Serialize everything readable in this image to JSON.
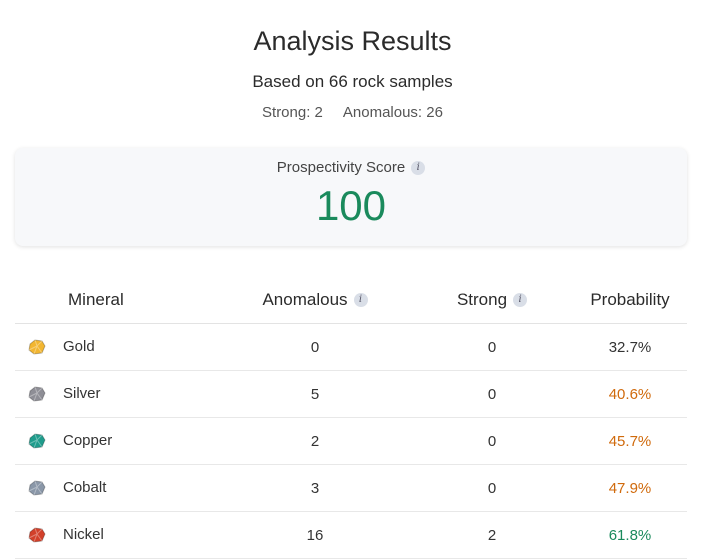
{
  "header": {
    "title": "Analysis Results",
    "subtitle": "Based on 66 rock samples",
    "strong_label": "Strong: 2",
    "anomalous_label": "Anomalous: 26"
  },
  "score": {
    "label": "Prospectivity Score",
    "value": "100",
    "info_icon": "i"
  },
  "table": {
    "columns": {
      "mineral": "Mineral",
      "anomalous": "Anomalous",
      "strong": "Strong",
      "probability": "Probability"
    },
    "info_icon": "i",
    "rows": [
      {
        "mineral": "Gold",
        "icon": "gold-ore-icon",
        "color": "#f2b631",
        "anomalous": "0",
        "strong": "0",
        "probability": "32.7%",
        "prob_color": "#333333"
      },
      {
        "mineral": "Silver",
        "icon": "silver-ore-icon",
        "color": "#8e8e96",
        "anomalous": "5",
        "strong": "0",
        "probability": "40.6%",
        "prob_color": "#d06a0c"
      },
      {
        "mineral": "Copper",
        "icon": "copper-ore-icon",
        "color": "#1f9c8c",
        "anomalous": "2",
        "strong": "0",
        "probability": "45.7%",
        "prob_color": "#d06a0c"
      },
      {
        "mineral": "Cobalt",
        "icon": "cobalt-ore-icon",
        "color": "#8a97a8",
        "anomalous": "3",
        "strong": "0",
        "probability": "47.9%",
        "prob_color": "#d06a0c"
      },
      {
        "mineral": "Nickel",
        "icon": "nickel-ore-icon",
        "color": "#d2402a",
        "anomalous": "16",
        "strong": "2",
        "probability": "61.8%",
        "prob_color": "#1a8a5c"
      }
    ]
  }
}
